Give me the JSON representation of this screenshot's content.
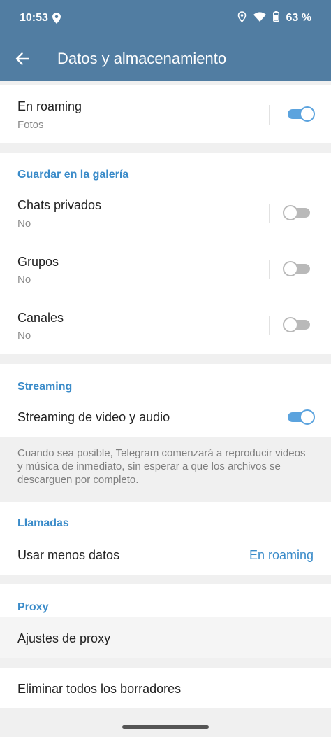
{
  "status": {
    "time": "10:53",
    "battery": "63 %"
  },
  "appbar": {
    "title": "Datos y almacenamiento"
  },
  "roaming": {
    "title": "En roaming",
    "sub": "Fotos",
    "on": true
  },
  "gallery": {
    "header": "Guardar en la galería",
    "items": [
      {
        "title": "Chats privados",
        "sub": "No",
        "on": false
      },
      {
        "title": "Grupos",
        "sub": "No",
        "on": false
      },
      {
        "title": "Canales",
        "sub": "No",
        "on": false
      }
    ]
  },
  "streaming": {
    "header": "Streaming",
    "item": {
      "title": "Streaming de video y audio",
      "on": true
    },
    "info": "Cuando sea posible, Telegram comenzará a reproducir videos y música de inmediato, sin esperar a que los archivos se descarguen por completo."
  },
  "calls": {
    "header": "Llamadas",
    "item": {
      "title": "Usar menos datos",
      "value": "En roaming"
    }
  },
  "proxy": {
    "header": "Proxy",
    "item": {
      "title": "Ajustes de proxy"
    }
  },
  "drafts": {
    "title": "Eliminar todos los borradores"
  },
  "colors": {
    "appbar": "#517da2",
    "accent": "#3a8bc9",
    "toggle_on": "#5ba3de",
    "toggle_off": "#b9b9b9"
  }
}
